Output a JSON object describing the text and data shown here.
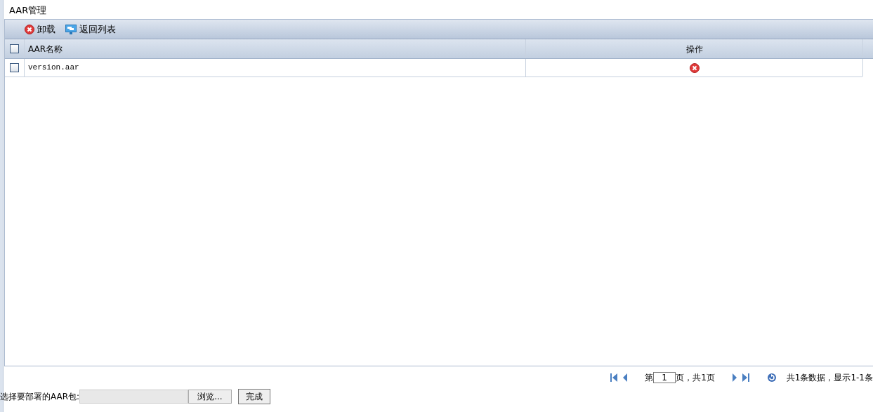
{
  "title": "AAR管理",
  "toolbar": [
    {
      "kind": "delete",
      "label": "卸载"
    },
    {
      "kind": "list",
      "label": "返回列表"
    }
  ],
  "table": {
    "select_all": {
      "checked": false
    },
    "columns": [
      "AAR名称",
      "操作"
    ],
    "rows": [
      {
        "selected": false,
        "name": "version.aar",
        "deletable": true
      }
    ]
  },
  "pager": {
    "before": "第",
    "page": "1",
    "after": "页，共1页",
    "summary": "共1条数据，显示1-1条"
  },
  "upload": {
    "label": "选择要部署的AAR包:",
    "browse": "浏览...",
    "submit": "完成"
  }
}
